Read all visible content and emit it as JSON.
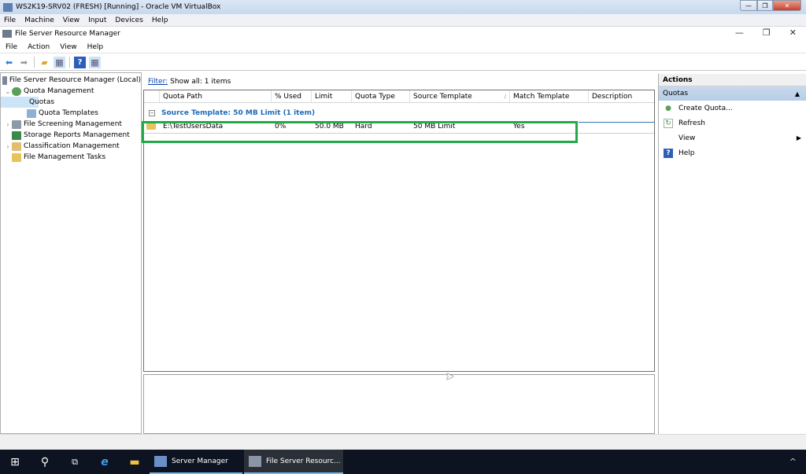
{
  "vbox": {
    "title": "WS2K19-SRV02 (FRESH) [Running] - Oracle VM VirtualBox",
    "menu": [
      "File",
      "Machine",
      "View",
      "Input",
      "Devices",
      "Help"
    ]
  },
  "app": {
    "title": "File Server Resource Manager",
    "menu": [
      "File",
      "Action",
      "View",
      "Help"
    ],
    "toolbar": [
      "back-icon",
      "forward-icon",
      "up-folder-icon",
      "show-hide-tree-icon",
      "help-icon",
      "show-hide-action-pane-icon"
    ]
  },
  "tree": [
    {
      "label": "File Server Resource Manager (Local)",
      "expander": "",
      "level": 0
    },
    {
      "label": "Quota Management",
      "expander": "⌄",
      "level": 1
    },
    {
      "label": "Quotas",
      "expander": "",
      "level": 2,
      "selected": true
    },
    {
      "label": "Quota Templates",
      "expander": "",
      "level": 2
    },
    {
      "label": "File Screening Management",
      "expander": "›",
      "level": 1
    },
    {
      "label": "Storage Reports Management",
      "expander": "",
      "level": 1
    },
    {
      "label": "Classification Management",
      "expander": "›",
      "level": 1
    },
    {
      "label": "File Management Tasks",
      "expander": "",
      "level": 1
    }
  ],
  "filter": {
    "link": "Filter:",
    "text": "Show all: 1 items"
  },
  "columns": [
    "Quota Path",
    "% Used",
    "Limit",
    "Quota Type",
    "Source Template",
    "Match Template",
    "Description"
  ],
  "group": {
    "box": "−",
    "label": "Source Template: 50 MB Limit (1 item)"
  },
  "rows": [
    [
      "E:\\TestUsersData",
      "0%",
      "50.0 MB",
      "Hard",
      "50 MB Limit",
      "Yes",
      ""
    ]
  ],
  "actions": {
    "header": "Actions",
    "section": "Quotas",
    "items": [
      {
        "label": "Create Quota...",
        "icon": "create-quota-icon"
      },
      {
        "label": "Refresh",
        "icon": "refresh-icon"
      },
      {
        "label": "View",
        "icon": "",
        "submenu": true
      },
      {
        "label": "Help",
        "icon": "help-icon"
      }
    ]
  },
  "taskbar": {
    "apps": [
      {
        "label": "Server Manager",
        "active": false
      },
      {
        "label": "File Server Resourc...",
        "active": true
      }
    ],
    "tray": "^"
  },
  "colors": {
    "highlight": "#23a84a",
    "group": "#1e6bb8"
  }
}
